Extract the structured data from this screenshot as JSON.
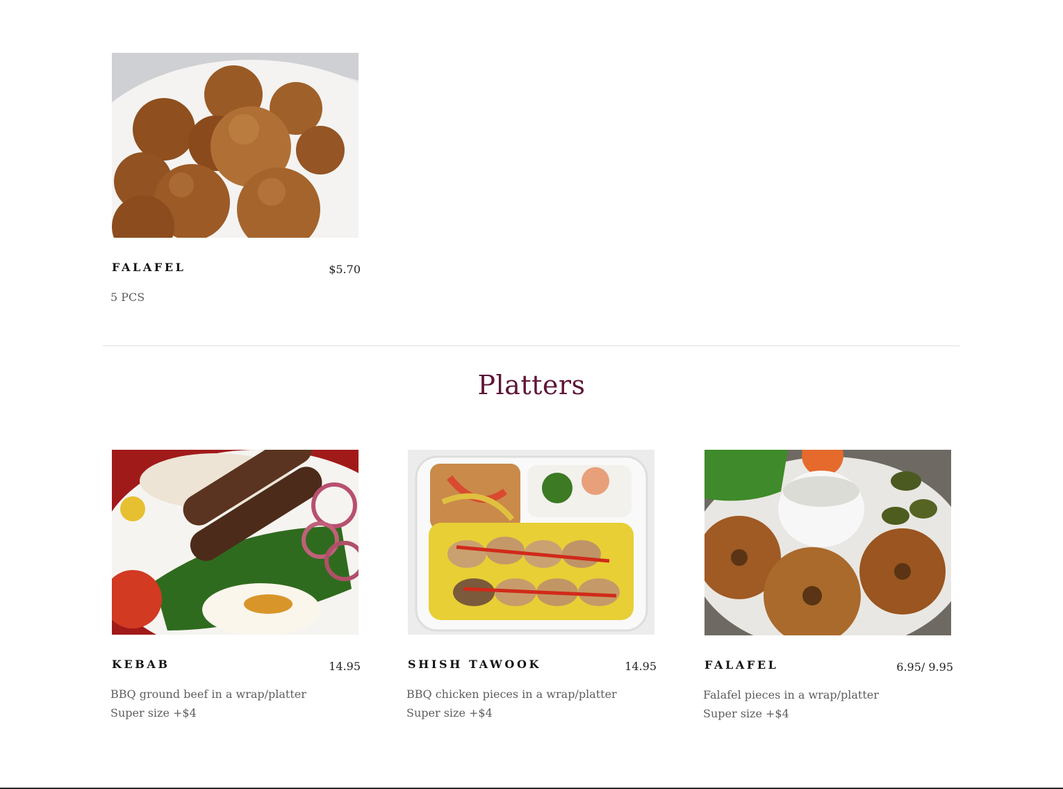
{
  "top_item": {
    "name": "FALAFEL",
    "price": "$5.70",
    "description": "5 PCS"
  },
  "platters": {
    "title": "Platters",
    "items": [
      {
        "name": "KEBAB",
        "price": "14.95",
        "description_line1": "BBQ ground beef in a wrap/platter",
        "description_line2": "Super size +$4"
      },
      {
        "name": "SHISH TAWOOK",
        "price": "14.95",
        "description_line1": "BBQ chicken pieces in a wrap/platter",
        "description_line2": "Super size +$4"
      },
      {
        "name": "FALAFEL",
        "price": "6.95/ 9.95",
        "description_line1": "Falafel pieces in a wrap/platter",
        "description_line2": "Super size +$4"
      }
    ]
  },
  "colors": {
    "section_title": "#5e1538",
    "item_name": "#111111",
    "description": "#5d5d5d",
    "divider": "#dedede"
  }
}
